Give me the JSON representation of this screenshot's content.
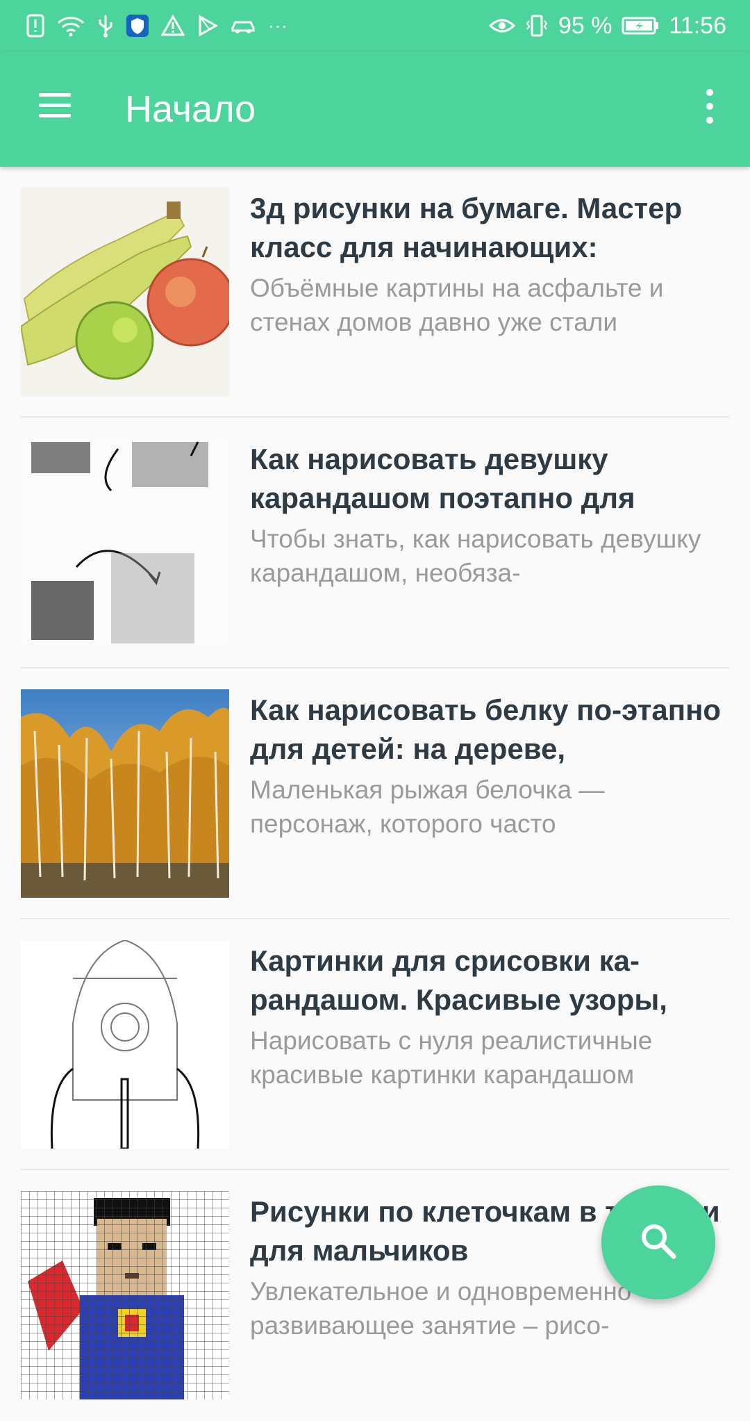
{
  "status_bar": {
    "battery": "95 %",
    "time": "11:56",
    "overflow": "···",
    "icons_left": [
      "alert-icon",
      "wifi-icon",
      "usb-icon",
      "shield-icon",
      "warning-icon",
      "play-store-icon",
      "car-icon",
      "more-dots-icon"
    ],
    "icons_right": [
      "eye-icon",
      "vibrate-icon",
      "battery-icon"
    ]
  },
  "app_bar": {
    "title": "Начало",
    "menu_icon": "menu-icon",
    "more_icon": "more-vert-icon"
  },
  "articles": [
    {
      "title": "3д рисунки на бумаге. Мастер класс для начинающих:",
      "description": "Объёмные картины на асфальте и стенах домов давно уже стали",
      "thumb": "fruits-drawing"
    },
    {
      "title": "Как нарисовать девушку карандашом поэтапно для",
      "description": "Чтобы знать, как нарисовать девушку карандашом, необяза-",
      "thumb": "pencil-shading"
    },
    {
      "title": "Как нарисовать белку по-этапно для детей: на дереве,",
      "description": "Маленькая рыжая белочка — персонаж, которого часто",
      "thumb": "autumn-forest"
    },
    {
      "title": "Картинки для срисовки ка-рандашом. Красивые узоры,",
      "description": "Нарисовать с нуля реалистичные красивые картинки карандашом",
      "thumb": "rocket-outline"
    },
    {
      "title": "Рисунки по клеточкам в тетради для мальчиков",
      "description": "Увлекательное и одновременно развивающее занятие – рисо-",
      "thumb": "pixel-superhero"
    }
  ],
  "fab": {
    "icon": "search-icon"
  },
  "colors": {
    "primary": "#4dd49c",
    "title_text": "#2f3b44",
    "desc_text": "#9a9a9a"
  }
}
